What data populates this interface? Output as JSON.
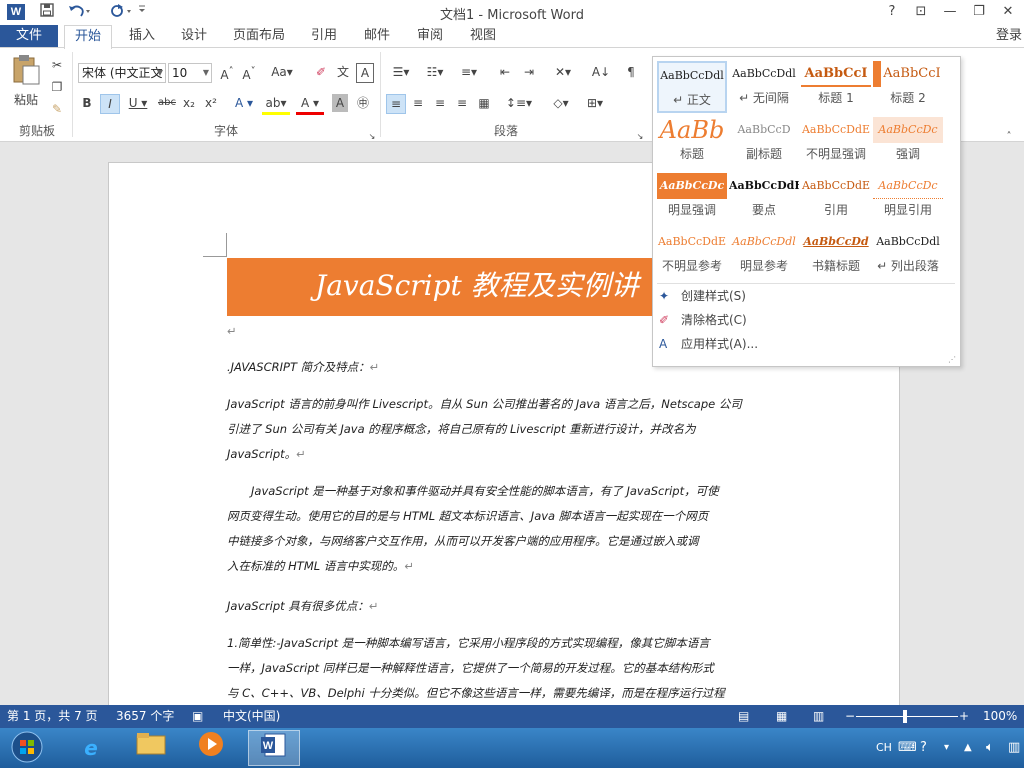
{
  "app": {
    "title": "文档1 - Microsoft Word",
    "icon_text": "W",
    "login": "登录"
  },
  "qat": {
    "save_icon": "save-icon",
    "undo_icon": "undo-icon",
    "redo_icon": "redo-icon",
    "customize_icon": "customize-qat-icon"
  },
  "window_controls": {
    "help": "?",
    "restore_ribbon": "⊡",
    "minimize": "—",
    "maximize": "❐",
    "close": "✕"
  },
  "tabs": [
    {
      "label": "文件"
    },
    {
      "label": "开始"
    },
    {
      "label": "插入"
    },
    {
      "label": "设计"
    },
    {
      "label": "页面布局"
    },
    {
      "label": "引用"
    },
    {
      "label": "邮件"
    },
    {
      "label": "审阅"
    },
    {
      "label": "视图"
    }
  ],
  "ribbon": {
    "clipboard": {
      "label": "剪贴板",
      "paste": "粘贴"
    },
    "font": {
      "label": "字体",
      "font_name": "宋体 (中文正文",
      "font_size": "10"
    },
    "paragraph": {
      "label": "段落"
    }
  },
  "styles_gallery": {
    "styles": [
      {
        "sample": "AaBbCcDdl",
        "label": "↵ 正文",
        "color": "#222222"
      },
      {
        "sample": "AaBbCcDdl",
        "label": "↵ 无间隔",
        "color": "#222222"
      },
      {
        "sample": "AaBbCcI",
        "label": "标题 1",
        "color": "#c55a11"
      },
      {
        "sample": "AaBbCcI",
        "label": "标题 2",
        "color": "#c55a11"
      },
      {
        "sample": "AaBb",
        "label": "标题",
        "color": "#ed7d31"
      },
      {
        "sample": "AaBbCcD",
        "label": "副标题",
        "color": "#888888"
      },
      {
        "sample": "AaBbCcDdE",
        "label": "不明显强调",
        "color": "#ed7d31"
      },
      {
        "sample": "AaBbCcDc",
        "label": "强调",
        "color": "#ed7d31"
      },
      {
        "sample": "AaBbCcDc",
        "label": "明显强调",
        "color": "#ffffff"
      },
      {
        "sample": "AaBbCcDdE",
        "label": "要点",
        "color": "#111111"
      },
      {
        "sample": "AaBbCcDdE",
        "label": "引用",
        "color": "#c55a11"
      },
      {
        "sample": "AaBbCcDc",
        "label": "明显引用",
        "color": "#ed7d31"
      },
      {
        "sample": "AaBbCcDdE",
        "label": "不明显参考",
        "color": "#ed7d31"
      },
      {
        "sample": "AaBbCcDdl",
        "label": "明显参考",
        "color": "#ed7d31"
      },
      {
        "sample": "AaBbCcDd",
        "label": "书籍标题",
        "color": "#c55a11"
      },
      {
        "sample": "AaBbCcDdl",
        "label": "↵ 列出段落",
        "color": "#222222"
      }
    ],
    "menu": [
      {
        "label": "创建样式(S)",
        "icon": "create-style-icon"
      },
      {
        "label": "清除格式(C)",
        "icon": "clear-formatting-icon"
      },
      {
        "label": "应用样式(A)...",
        "icon": "apply-styles-icon"
      }
    ]
  },
  "document": {
    "title": "JavaScript 教程及实例讲",
    "paragraphs": [
      {
        "text": ".JAVASCRIPT 简介及特点：",
        "lines": [
          "..."
        ]
      },
      {
        "text": ""
      }
    ],
    "p1": ".JAVASCRIPT 简介及特点：",
    "p2a": "JavaScript 语言的前身叫作 Livescript。自从 Sun 公司推出著名的 Java 语言之后，Netscape 公司",
    "p2b": "引进了 Sun 公司有关 Java 的程序概念，将自己原有的 Livescript  重新进行设计，并改名为",
    "p2c": "JavaScript。",
    "p3a": "JavaScript 是一种基于对象和事件驱动并具有安全性能的脚本语言，有了 JavaScript，可使",
    "p3b": "网页变得生动。使用它的目的是与 HTML 超文本标识语言、Java  脚本语言一起实现在一个网页",
    "p3c": "中链接多个对象，与网络客户交互作用，从而可以开发客户端的应用程序。它是通过嵌入或调",
    "p3d": "入在标准的 HTML 语言中实现的。",
    "p4": "JavaScript 具有很多优点：",
    "p5a": "1.简单性:-JavaScript 是一种脚本编写语言，它采用小程序段的方式实现编程，像其它脚本语言",
    "p5b": "一样，JavaScript 同样已是一种解释性语言，它提供了一个简易的开发过程。它的基本结构形式",
    "p5c": "与 C、C++、VB、Delphi 十分类似。但它不像这些语言一样，需要先编译，而是在程序运行过程",
    "pilcrow": "↵"
  },
  "status": {
    "page": "第 1 页，共 7 页",
    "words": "3657 个字",
    "language": "中文(中国)",
    "zoom": "100%"
  },
  "taskbar": {
    "ime": "CH"
  },
  "colors": {
    "word_blue": "#2b579a",
    "accent_orange": "#ed7d31"
  }
}
